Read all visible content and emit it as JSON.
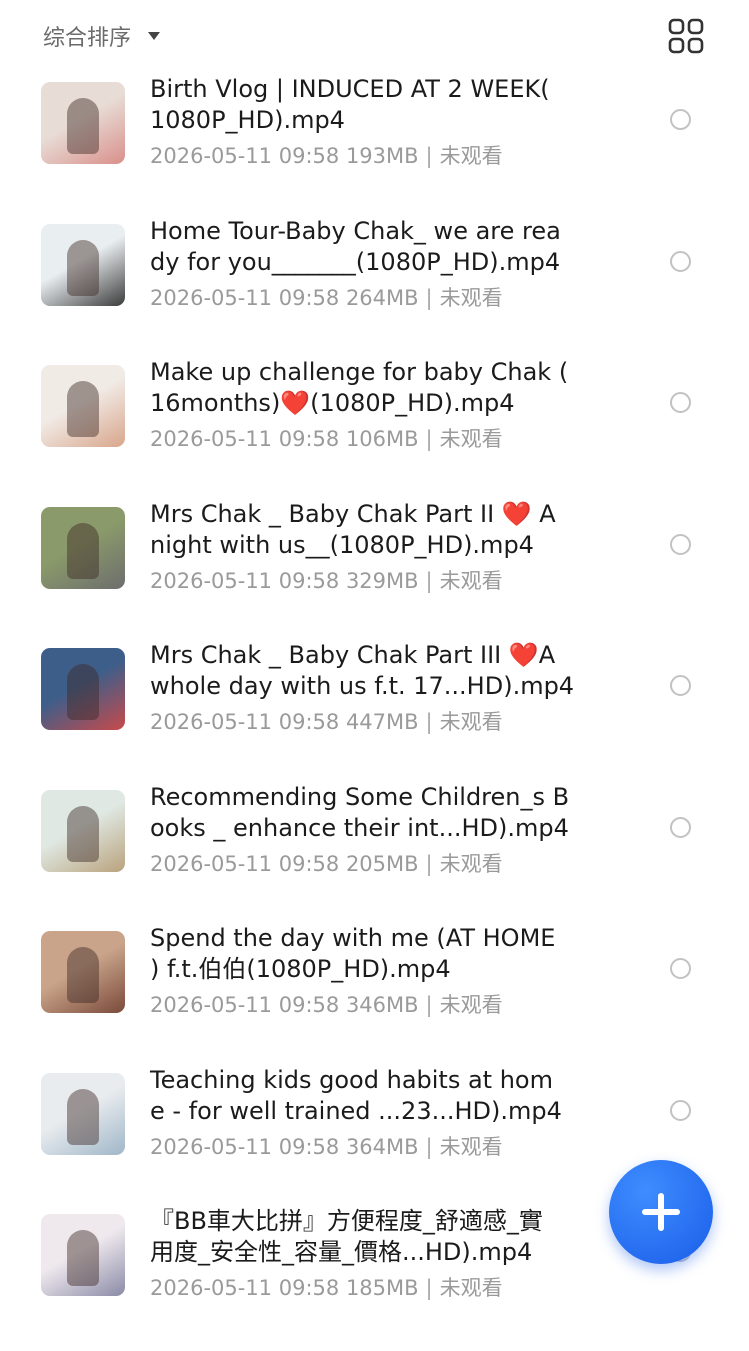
{
  "header": {
    "sort_label": "综合排序",
    "sort_caret_icon": "caret-down-icon",
    "view_toggle_icon": "grid-view-icon"
  },
  "videos": [
    {
      "title": "Birth Vlog | INDUCED AT 2 WEEK(\n1080P_HD).mp4",
      "date": "2026-05-11 09:58",
      "size": "193MB",
      "status": "未观看",
      "thumb_colors": [
        "#e8dcd6",
        "#d98f8a"
      ]
    },
    {
      "title": "Home Tour-Baby Chak_ we are rea\ndy for you_______(1080P_HD).mp4",
      "date": "2026-05-11 09:58",
      "size": "264MB",
      "status": "未观看",
      "thumb_colors": [
        "#e9eef0",
        "#3b3b3b"
      ]
    },
    {
      "title": "Make up challenge for baby Chak (\n16months)❤️(1080P_HD).mp4",
      "date": "2026-05-11 09:58",
      "size": "106MB",
      "status": "未观看",
      "thumb_colors": [
        "#f1ebe6",
        "#d8a58b"
      ]
    },
    {
      "title": "Mrs Chak _ Baby Chak Part II ❤️ A\nnight with us__(1080P_HD).mp4",
      "date": "2026-05-11 09:58",
      "size": "329MB",
      "status": "未观看",
      "thumb_colors": [
        "#8a9a6a",
        "#6d6d6d"
      ]
    },
    {
      "title": "Mrs Chak _ Baby Chak Part III ❤️A\nwhole day with us f.t. 17...HD).mp4",
      "date": "2026-05-11 09:58",
      "size": "447MB",
      "status": "未观看",
      "thumb_colors": [
        "#3e5e8a",
        "#c84a4a"
      ]
    },
    {
      "title": "Recommending Some Children_s B\nooks _ enhance their int...HD).mp4",
      "date": "2026-05-11 09:58",
      "size": "205MB",
      "status": "未观看",
      "thumb_colors": [
        "#dfe8e2",
        "#b9a27c"
      ]
    },
    {
      "title": "Spend the day with me (AT HOME\n) f.t.伯伯(1080P_HD).mp4",
      "date": "2026-05-11 09:58",
      "size": "346MB",
      "status": "未观看",
      "thumb_colors": [
        "#c9a48a",
        "#7a4a3a"
      ]
    },
    {
      "title": "Teaching kids good habits at hom\ne - for well trained ...23...HD).mp4",
      "date": "2026-05-11 09:58",
      "size": "364MB",
      "status": "未观看",
      "thumb_colors": [
        "#e9ecef",
        "#9fb6c8"
      ]
    },
    {
      "title": "『BB車大比拼』方便程度_舒適感_實\n用度_安全性_容量_價格...HD).mp4",
      "date": "2026-05-11 09:58",
      "size": "185MB",
      "status": "未观看",
      "thumb_colors": [
        "#efe9ee",
        "#8a8aa6"
      ]
    }
  ],
  "fab": {
    "icon": "plus-icon",
    "color": "#1a5de8"
  }
}
